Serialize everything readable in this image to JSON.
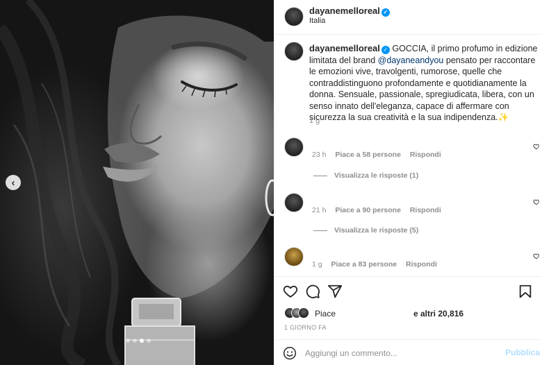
{
  "post": {
    "author": "dayanemelloreal",
    "location": "Italia",
    "media_alt": "Black-and-white portrait photo holding a perfume bottle",
    "carousel_total": 4,
    "carousel_active": 3
  },
  "caption": {
    "author": "dayanemelloreal",
    "text_before": "GOCCIA, il primo profumo in edizione limitata del brand ",
    "mention": "@dayaneandyou",
    "text_after": " pensato per raccontare le emozioni vive, travolgenti, rumorose, quelle che contraddistinguono profondamente e quotidianamente la donna. Sensuale, passionale, spregiudicata, libera, con un senso innato dell'eleganza, capace di affermare con sicurezza la sua creatività e la sua indipendenza.✨",
    "time": "1 g"
  },
  "comments": [
    {
      "time": "23 h",
      "likes": "Piace a 58 persone",
      "reply": "Rispondi",
      "view_replies": "Visualizza le risposte (1)"
    },
    {
      "time": "21 h",
      "likes": "Piace a 90 persone",
      "reply": "Rispondi",
      "view_replies": "Visualizza le risposte (5)"
    },
    {
      "time": "1 g",
      "likes": "Piace a 83 persone",
      "reply": "Rispondi"
    }
  ],
  "likes_summary": {
    "prefix": "Piace",
    "suffix": "e altri 20,816"
  },
  "posted_ago": "1 GIORNO FA",
  "add_comment": {
    "placeholder": "Aggiungi un commento...",
    "publish_label": "Pubblica"
  },
  "icons": [
    "arrow-left-icon",
    "verified-badge-icon",
    "heart-icon",
    "comment-icon",
    "share-icon",
    "bookmark-icon",
    "emoji-icon"
  ],
  "colors": {
    "verified": "#0095f6",
    "mention": "#00376b",
    "publish_disabled": "#b2dffc",
    "muted": "#8e8e8e"
  }
}
